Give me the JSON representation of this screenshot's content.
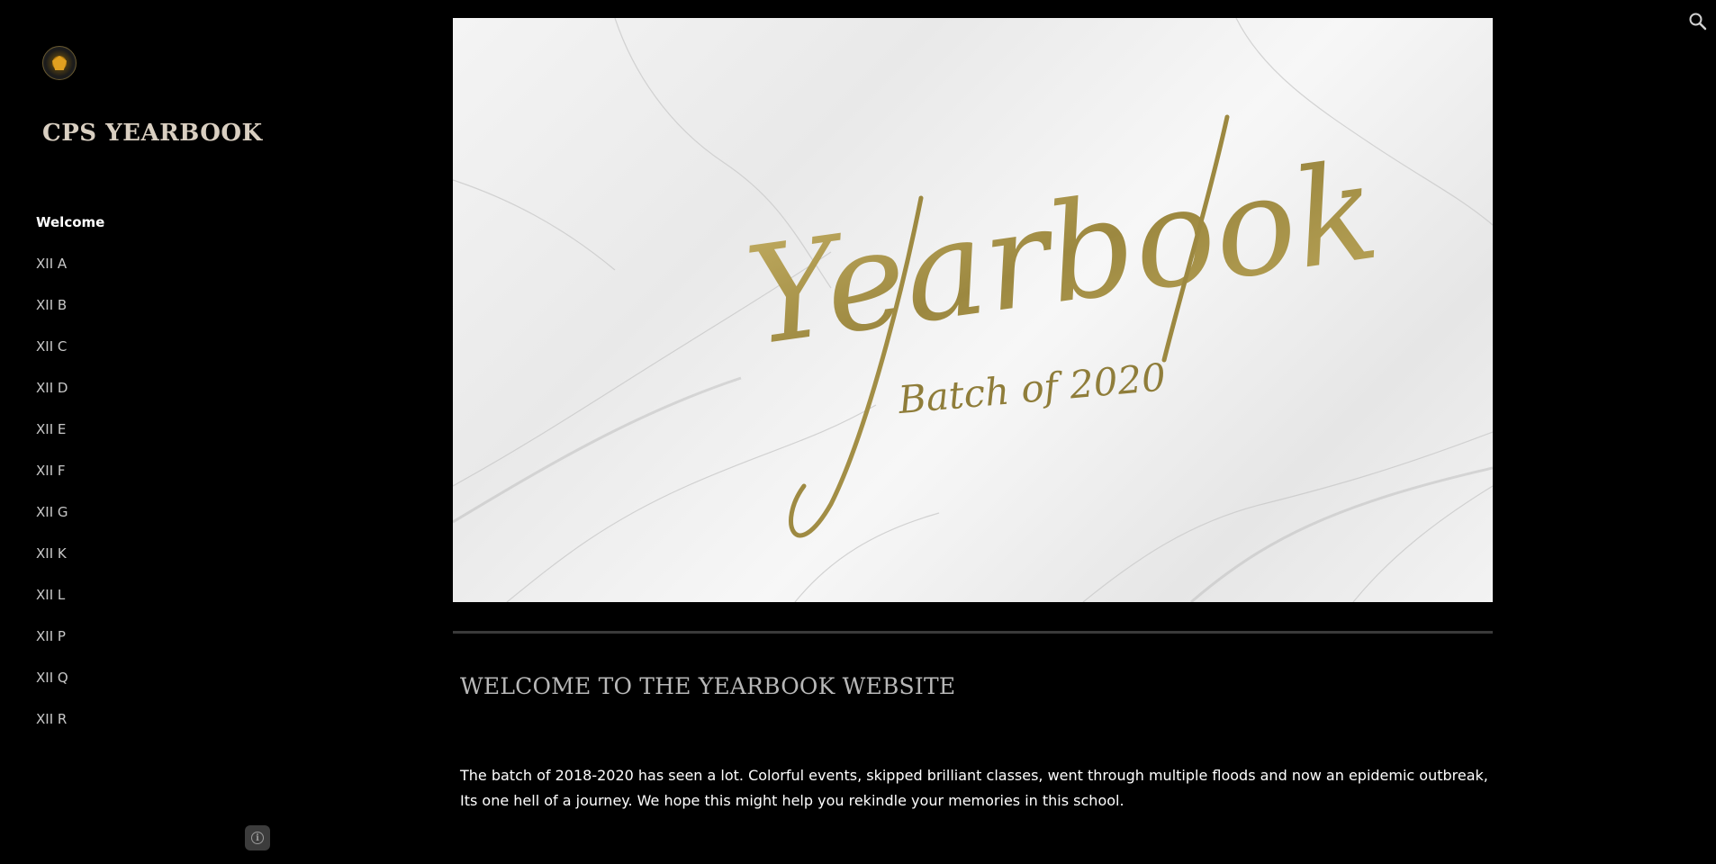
{
  "site": {
    "title": "CPS YEARBOOK"
  },
  "nav": {
    "items": [
      {
        "label": "Welcome",
        "active": true
      },
      {
        "label": "XII A"
      },
      {
        "label": "XII B"
      },
      {
        "label": "XII C"
      },
      {
        "label": "XII D"
      },
      {
        "label": "XII E"
      },
      {
        "label": "XII F"
      },
      {
        "label": "XII G"
      },
      {
        "label": "XII K"
      },
      {
        "label": "XII L"
      },
      {
        "label": "XII P"
      },
      {
        "label": "XII Q"
      },
      {
        "label": "XII R"
      }
    ]
  },
  "hero": {
    "script_title": "Yearbook",
    "subtitle": "Batch of 2020"
  },
  "main": {
    "heading": "WELCOME TO THE YEARBOOK WEBSITE",
    "body": "The batch of 2018-2020 has seen a lot. Colorful events, skipped brilliant classes, went through multiple floods and now an epidemic outbreak, Its one hell of a journey. We hope this might help you rekindle your memories in this school."
  },
  "icons": {
    "search": "search-icon",
    "info": "info-icon",
    "logo": "school-crest-logo"
  },
  "colors": {
    "background": "#000000",
    "gold": "#a8944a",
    "nav_text": "#c8c8c8"
  }
}
